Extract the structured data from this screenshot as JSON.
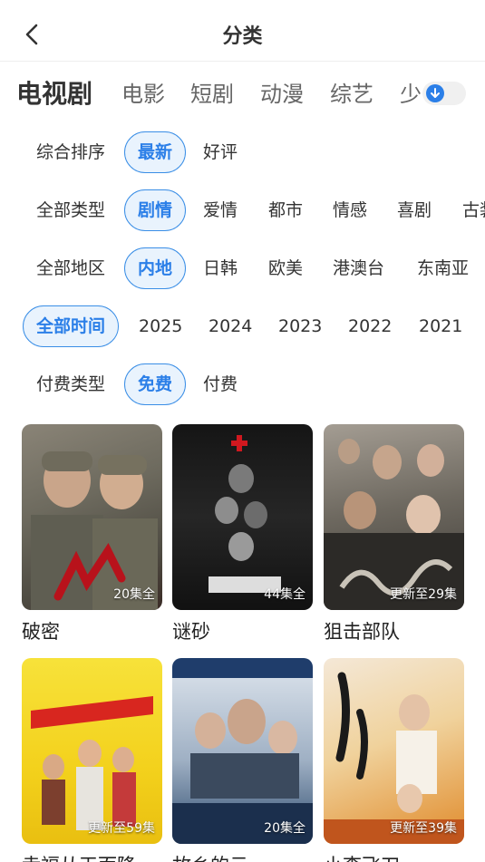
{
  "header": {
    "title": "分类"
  },
  "categories": [
    "电视剧",
    "电影",
    "短剧",
    "动漫",
    "综艺",
    "少"
  ],
  "filters": {
    "sort": [
      "综合排序",
      "最新",
      "好评"
    ],
    "genre": [
      "全部类型",
      "剧情",
      "爱情",
      "都市",
      "情感",
      "喜剧",
      "古装"
    ],
    "region": [
      "全部地区",
      "内地",
      "日韩",
      "欧美",
      "港澳台",
      "东南亚"
    ],
    "year": [
      "全部时间",
      "2025",
      "2024",
      "2023",
      "2022",
      "2021"
    ],
    "pay": [
      "付费类型",
      "免费",
      "付费"
    ]
  },
  "shows": [
    {
      "title": "破密",
      "episodes": "20集全"
    },
    {
      "title": "谜砂",
      "episodes": "44集全"
    },
    {
      "title": "狙击部队",
      "episodes": "更新至29集"
    },
    {
      "title": "幸福从天而降",
      "episodes": "更新至59集"
    },
    {
      "title": "故乡的云",
      "episodes": "20集全"
    },
    {
      "title": "小李飞刀",
      "episodes": "更新至39集"
    }
  ],
  "colors": {
    "accent": "#2b7fe8",
    "chip_bg": "#e9f3fd"
  },
  "icons": {
    "back": "chevron-left-icon",
    "toggle": "arrow-down-icon"
  }
}
